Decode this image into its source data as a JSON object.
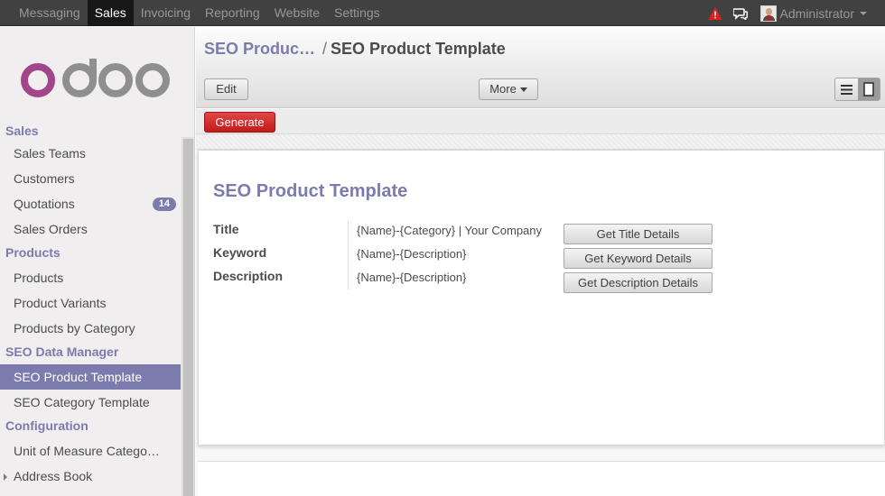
{
  "topbar": {
    "menu": [
      "Messaging",
      "Sales",
      "Invoicing",
      "Reporting",
      "Website",
      "Settings"
    ],
    "active_menu": "Sales",
    "user_name": "Administrator",
    "colors": {
      "background": "#414141",
      "active": "#181818",
      "alert": "#e02020"
    }
  },
  "sidebar": {
    "logo_text": "odoo",
    "sections": [
      {
        "title": "Sales",
        "items": [
          {
            "label": "Sales Teams"
          },
          {
            "label": "Customers"
          },
          {
            "label": "Quotations",
            "badge": "14"
          },
          {
            "label": "Sales Orders"
          }
        ]
      },
      {
        "title": "Products",
        "items": [
          {
            "label": "Products"
          },
          {
            "label": "Product Variants"
          },
          {
            "label": "Products by Category"
          }
        ]
      },
      {
        "title": "SEO Data Manager",
        "items": [
          {
            "label": "SEO Product Template",
            "active": true
          },
          {
            "label": "SEO Category Template"
          }
        ]
      },
      {
        "title": "Configuration",
        "items": [
          {
            "label": "Unit of Measure Catego…"
          },
          {
            "label": "Address Book",
            "expandable": true
          }
        ]
      }
    ],
    "accent_color": "#7c7bad"
  },
  "header": {
    "breadcrumb_link": "SEO Produc…",
    "breadcrumb_separator": "/",
    "breadcrumb_current": "SEO Product Template",
    "edit_label": "Edit",
    "more_label": "More",
    "view_list_icon": "list-icon",
    "view_form_icon": "form-view-icon"
  },
  "statusbar": {
    "generate_label": "Generate",
    "generate_color": "#c21c1c"
  },
  "form": {
    "title": "SEO Product Template",
    "fields": [
      {
        "label": "Title",
        "value": "{Name}-{Category} | Your Company"
      },
      {
        "label": "Keyword",
        "value": "{Name}-{Description}"
      },
      {
        "label": "Description",
        "value": "{Name}-{Description}"
      }
    ],
    "buttons": [
      "Get Title Details",
      "Get Keyword Details",
      "Get Description Details"
    ]
  }
}
